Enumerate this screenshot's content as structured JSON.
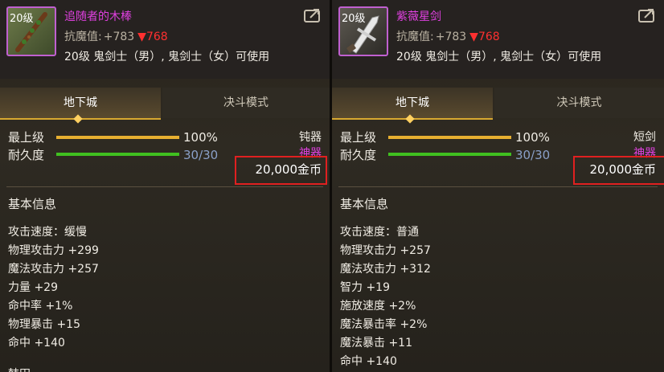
{
  "tooltips": [
    {
      "level_badge": "20级",
      "name": "追随者的木棒",
      "icon": "wooden-staff-icon",
      "magic_resist_label": "抗魔值:",
      "magic_resist_plus": "+783",
      "magic_resist_drop": "▼768",
      "usable_by": "20级 鬼剑士（男）, 鬼剑士（女）可使用",
      "tabs": [
        "地下城",
        "决斗模式"
      ],
      "stats": {
        "max_grade_label": "最上级",
        "max_grade_value": "100%",
        "max_grade_fraction": 1.0,
        "durability_label": "耐久度",
        "durability_value": "30/30",
        "durability_fraction": 1.0
      },
      "weapon_type": "钝器",
      "rarity": "神器",
      "price": "20,000金币",
      "section_title": "基本信息",
      "attributes": [
        "攻击速度：缓慢",
        "物理攻击力 +299",
        "魔法攻击力 +257",
        "力量 +29",
        "命中率 +1%",
        "物理暴击 +15",
        "命中 +140"
      ],
      "cut_text": "韩田"
    },
    {
      "level_badge": "20级",
      "name": "紫薇星剑",
      "icon": "sword-icon",
      "magic_resist_label": "抗魔值:",
      "magic_resist_plus": "+783",
      "magic_resist_drop": "▼768",
      "usable_by": "20级 鬼剑士（男）, 鬼剑士（女）可使用",
      "tabs": [
        "地下城",
        "决斗模式"
      ],
      "stats": {
        "max_grade_label": "最上级",
        "max_grade_value": "100%",
        "max_grade_fraction": 1.0,
        "durability_label": "耐久度",
        "durability_value": "30/30",
        "durability_fraction": 1.0
      },
      "weapon_type": "短剑",
      "rarity": "神器",
      "price": "20,000金币",
      "section_title": "基本信息",
      "attributes": [
        "攻击速度：普通",
        "物理攻击力 +257",
        "魔法攻击力 +312",
        "智力 +19",
        "施放速度 +2%",
        "魔法暴击率 +2%",
        "魔法暴击 +11",
        "命中 +140"
      ],
      "cut_text": ""
    }
  ],
  "colors": {
    "item_name": "#e040e0",
    "rarity": "#e040e0",
    "drop": "#ff3030",
    "grade_bar": "#e8b030",
    "durability_bar": "#40c020",
    "highlight_box": "#e02020"
  }
}
